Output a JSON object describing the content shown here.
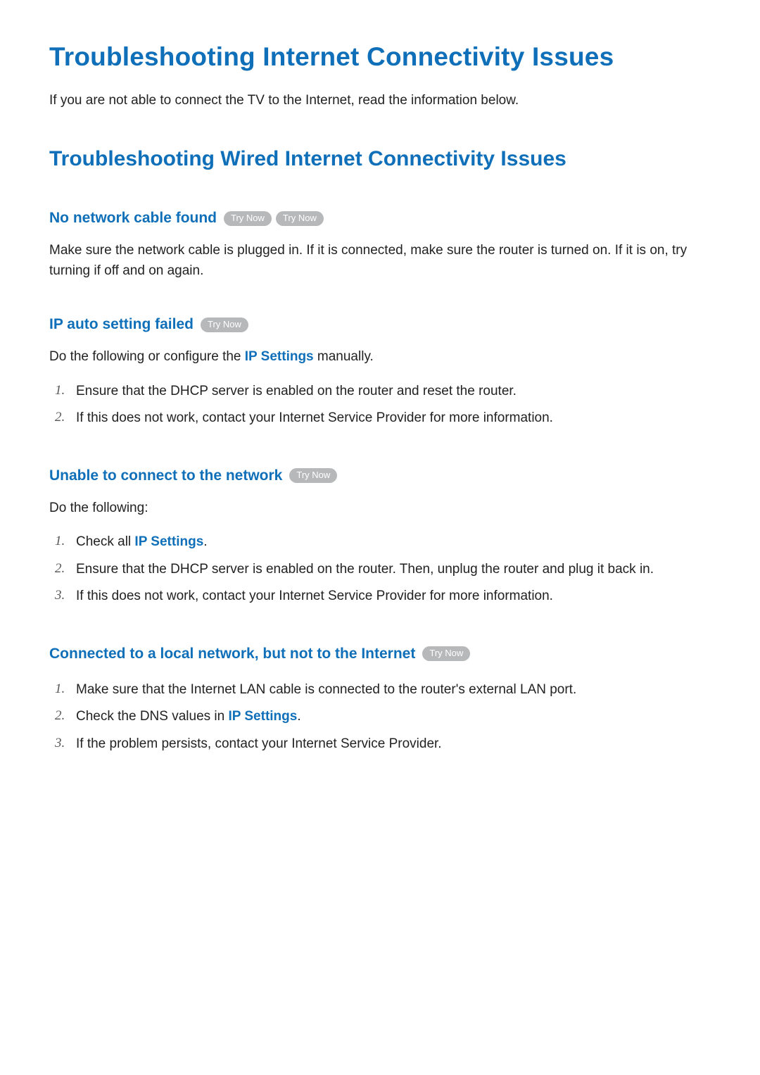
{
  "title": "Troubleshooting Internet Connectivity Issues",
  "intro": "If you are not able to connect the TV to the Internet, read the information below.",
  "section_title": "Troubleshooting Wired Internet Connectivity Issues",
  "try_now_label": "Try Now",
  "ip_settings_label": "IP Settings",
  "sub1": {
    "title": "No network cable found",
    "body": "Make sure the network cable is plugged in. If it is connected, make sure the router is turned on. If it is on, try turning if off and on again."
  },
  "sub2": {
    "title": "IP auto setting failed",
    "lead_pre": "Do the following or configure the ",
    "lead_post": " manually.",
    "step1": "Ensure that the DHCP server is enabled on the router and reset the router.",
    "step2": "If this does not work, contact your Internet Service Provider for more information."
  },
  "sub3": {
    "title": "Unable to connect to the network",
    "lead": "Do the following:",
    "step1_pre": "Check all ",
    "step1_post": ".",
    "step2": "Ensure that the DHCP server is enabled on the router. Then, unplug the router and plug it back in.",
    "step3": "If this does not work, contact your Internet Service Provider for more information."
  },
  "sub4": {
    "title": "Connected to a local network, but not to the Internet",
    "step1": "Make sure that the Internet LAN cable is connected to the router's external LAN port.",
    "step2_pre": "Check the DNS values in ",
    "step2_post": ".",
    "step3": "If the problem persists, contact your Internet Service Provider."
  },
  "nums": {
    "n1": "1.",
    "n2": "2.",
    "n3": "3."
  }
}
